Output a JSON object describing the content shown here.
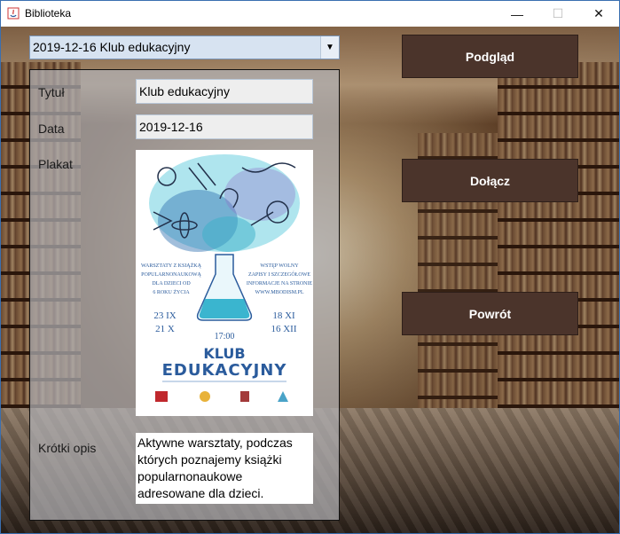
{
  "window": {
    "title": "Biblioteka",
    "minimize_glyph": "—",
    "maximize_glyph": "☐",
    "close_glyph": "✕"
  },
  "event_select": {
    "selected": "2019-12-16 Klub edukacyjny",
    "arrow_glyph": "▼"
  },
  "form": {
    "title_label": "Tytuł",
    "title_value": "Klub edukacyjny",
    "date_label": "Data",
    "date_value": "2019-12-16",
    "poster_label": "Plakat",
    "description_label": "Krótki opis",
    "description_value": "Aktywne warsztaty, podczas których poznajemy książki popularnonaukowe adresowane dla dzieci."
  },
  "poster": {
    "left_text": [
      "WARSZTATY Z KSIĄŻKĄ",
      "POPULARNONAUKOWĄ",
      "DLA DZIECI OD",
      "6 ROKU ŻYCIA"
    ],
    "right_text": [
      "WSTĘP WOLNY",
      "ZAPISY I SZCZEGÓŁOWE",
      "INFORMACJE NA STRONIE",
      "WWW.MBODISM.PL"
    ],
    "dates_left": [
      "23 IX",
      "21 X"
    ],
    "dates_right": [
      "18 XI",
      "16 XII"
    ],
    "time": "17:00",
    "headline": [
      "KLUB",
      "EDUKACYJNY"
    ]
  },
  "buttons": {
    "preview": "Podgląd",
    "join": "Dołącz",
    "back": "Powrót"
  },
  "colors": {
    "button_bg": "#4b342b",
    "combo_bg": "#d7e3f1",
    "poster_accent": "#2a5b9c",
    "poster_teal": "#5ec4d8"
  }
}
